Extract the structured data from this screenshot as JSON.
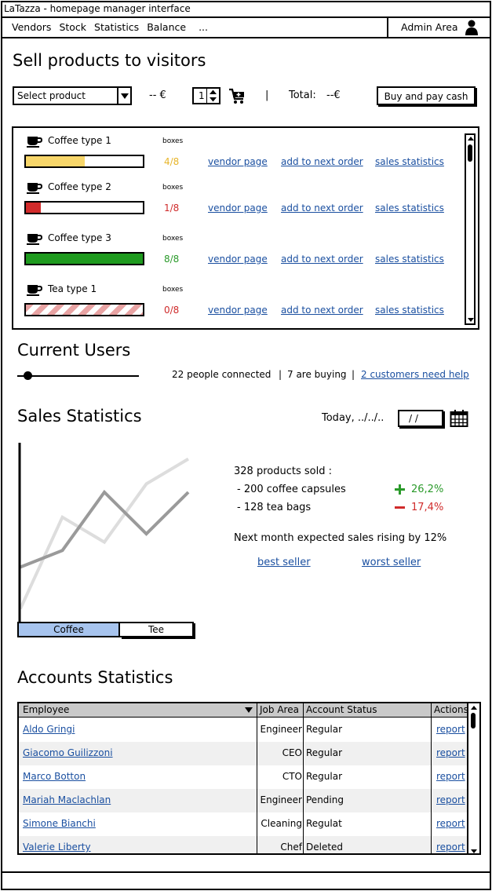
{
  "window": {
    "title": "LaTazza - homepage manager interface"
  },
  "menu": {
    "items": [
      "Vendors",
      "Stock",
      "Statistics",
      "Balance",
      "..."
    ],
    "admin_label": "Admin Area"
  },
  "sell": {
    "heading": "Sell products to visitors",
    "select_placeholder": "Select product",
    "price": "-- €",
    "quantity": "1",
    "separator": "|",
    "total_label": "Total:",
    "total_value": "--€",
    "buy_button": "Buy and pay cash"
  },
  "products": [
    {
      "name": "Coffee type 1",
      "boxes_label": "boxes",
      "count": "4/8",
      "fraction": 0.5,
      "status": "warning",
      "vendor": "vendor page",
      "order": "add to next order",
      "stats": "sales statistics"
    },
    {
      "name": "Coffee type 2",
      "boxes_label": "boxes",
      "count": "1/8",
      "fraction": 0.125,
      "status": "low",
      "vendor": "vendor page",
      "order": "add to next order",
      "stats": "sales statistics"
    },
    {
      "name": "Coffee type 3",
      "boxes_label": "boxes",
      "count": "8/8",
      "fraction": 1.0,
      "status": "full",
      "vendor": "vendor page",
      "order": "add to next order",
      "stats": "sales statistics"
    },
    {
      "name": "Tea type 1",
      "boxes_label": "boxes",
      "count": "0/8",
      "fraction": 0.0,
      "status": "empty",
      "vendor": "vendor page",
      "order": "add to next order",
      "stats": "sales statistics"
    }
  ],
  "colors": {
    "warning": "#f7d66a",
    "low": "#d22b2b",
    "full": "#1e9a1e",
    "empty_stripe": "#e8a3a3",
    "count_warning": "#e7b52a",
    "count_low": "#cf2b2b",
    "count_full": "#2a9a2a",
    "count_empty": "#cf2b2b",
    "link": "#1a4fa0",
    "tab_active": "#a7c4ee"
  },
  "users": {
    "heading": "Current Users",
    "connected": "22 people connected",
    "sep1": "|",
    "buying": "7 are buying",
    "sep2": "|",
    "help_link": "2 customers need help"
  },
  "sales": {
    "heading": "Sales Statistics",
    "date_label": "Today, ../../..",
    "date_value": "/ /",
    "sold_summary": "328 products sold :",
    "line1": "- 200 coffee capsules",
    "line1_change": "26,2%",
    "line2": "- 128 tea bags",
    "line2_change": "17,4%",
    "forecast": "Next month expected sales rising by 12%",
    "best_link": "best seller",
    "worst_link": "worst seller",
    "tab_coffee": "Coffee",
    "tab_tea": "Tee"
  },
  "chart_data": {
    "type": "line",
    "title": "",
    "xlabel": "",
    "ylabel": "",
    "x": [
      0,
      1,
      2,
      3,
      4
    ],
    "series": [
      {
        "values": [
          0.3,
          0.4,
          0.75,
          0.5,
          0.75
        ],
        "color": "#9a9a9a"
      },
      {
        "values": [
          0.05,
          0.6,
          0.45,
          0.8,
          0.95
        ],
        "color": "#dddddd"
      }
    ],
    "ylim": [
      0,
      1
    ],
    "grid": false
  },
  "accounts": {
    "heading": "Accounts Statistics",
    "columns": [
      "Employee",
      "Job Area",
      "Account Status",
      "Actions"
    ],
    "rows": [
      {
        "employee": "Aldo Gringi",
        "job": "Engineer",
        "status": "Regular",
        "action": "report"
      },
      {
        "employee": "Giacomo Guilizzoni",
        "job": "CEO",
        "status": "Regular",
        "action": "report"
      },
      {
        "employee": "Marco Botton",
        "job": "CTO",
        "status": "Regular",
        "action": "report"
      },
      {
        "employee": "Mariah Maclachlan",
        "job": "Engineer",
        "status": "Pending",
        "action": "report"
      },
      {
        "employee": "Simone Bianchi",
        "job": "Cleaning",
        "status": "Regulat",
        "action": "report"
      },
      {
        "employee": "Valerie Liberty",
        "job": "Chef",
        "status": "Deleted",
        "action": "report"
      }
    ]
  }
}
